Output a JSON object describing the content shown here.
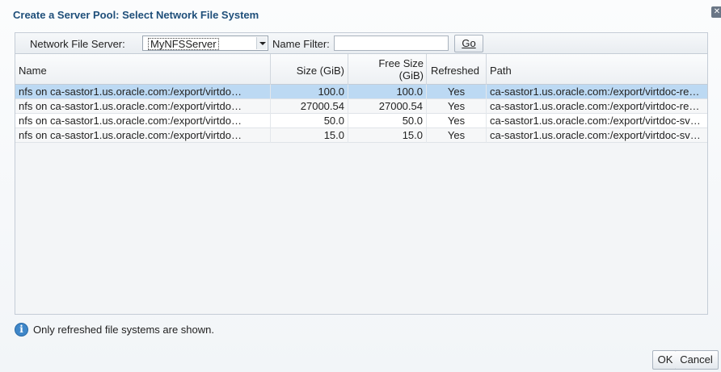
{
  "dialog": {
    "title": "Create a Server Pool: Select Network File System",
    "close_icon": "close-icon"
  },
  "toolbar": {
    "server_label": "Network File Server:",
    "server_value": "MyNFSServer",
    "filter_label": "Name Filter:",
    "filter_value": "",
    "go_label": "Go"
  },
  "table": {
    "columns": {
      "name": "Name",
      "size": "Size (GiB)",
      "free_size_line1": "Free Size",
      "free_size_line2": "(GiB)",
      "refreshed": "Refreshed",
      "path": "Path"
    },
    "rows": [
      {
        "name": "nfs on ca-sastor1.us.oracle.com:/export/virtdo…",
        "size": "100.0",
        "free": "100.0",
        "refreshed": "Yes",
        "path": "ca-sastor1.us.oracle.com:/export/virtdoc-re…"
      },
      {
        "name": "nfs on ca-sastor1.us.oracle.com:/export/virtdo…",
        "size": "27000.54",
        "free": "27000.54",
        "refreshed": "Yes",
        "path": "ca-sastor1.us.oracle.com:/export/virtdoc-re…"
      },
      {
        "name": "nfs on ca-sastor1.us.oracle.com:/export/virtdo…",
        "size": "50.0",
        "free": "50.0",
        "refreshed": "Yes",
        "path": "ca-sastor1.us.oracle.com:/export/virtdoc-sv…"
      },
      {
        "name": "nfs on ca-sastor1.us.oracle.com:/export/virtdo…",
        "size": "15.0",
        "free": "15.0",
        "refreshed": "Yes",
        "path": "ca-sastor1.us.oracle.com:/export/virtdoc-sv…"
      }
    ]
  },
  "info": {
    "icon": "info-icon",
    "text": "Only refreshed file systems are shown."
  },
  "buttons": {
    "ok": "OK",
    "cancel": "Cancel"
  }
}
